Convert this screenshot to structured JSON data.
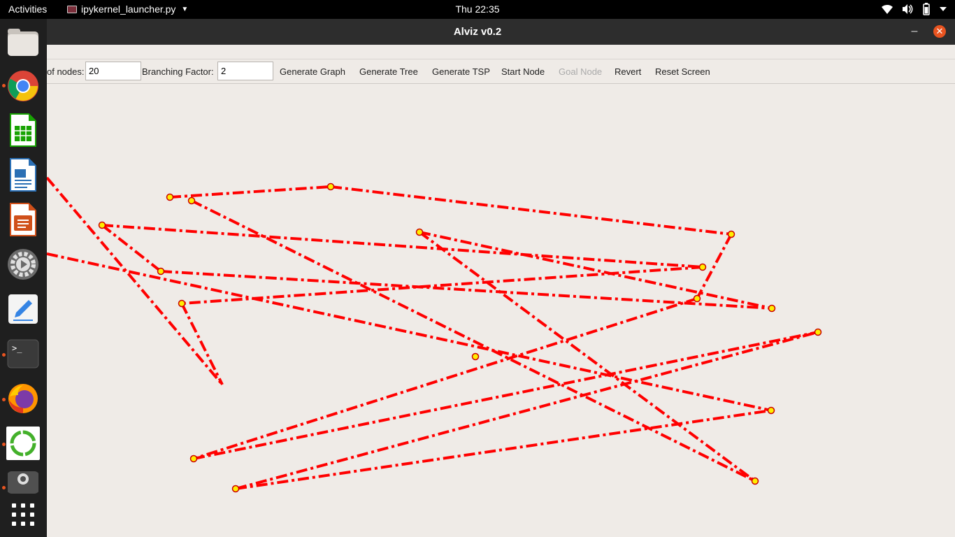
{
  "topbar": {
    "activities": "Activities",
    "app_name": "ipykernel_launcher.py",
    "clock": "Thu 22:35"
  },
  "dock": {
    "items": [
      {
        "name": "files-icon"
      },
      {
        "name": "chrome-icon"
      },
      {
        "name": "libreoffice-calc-icon"
      },
      {
        "name": "libreoffice-writer-icon"
      },
      {
        "name": "libreoffice-impress-icon"
      },
      {
        "name": "settings-icon"
      },
      {
        "name": "text-editor-icon"
      },
      {
        "name": "terminal-icon"
      },
      {
        "name": "firefox-icon"
      },
      {
        "name": "anaconda-icon"
      },
      {
        "name": "screenshot-icon"
      },
      {
        "name": "show-applications-icon"
      }
    ]
  },
  "window": {
    "title": "Alviz v0.2",
    "minimize": "–",
    "close": "✕"
  },
  "toolbar": {
    "nodes_label": "of nodes:",
    "nodes_value": "20",
    "branching_label": "Branching Factor:",
    "branching_value": "2",
    "generate_graph": "Generate Graph",
    "generate_tree": "Generate Tree",
    "generate_tsp": "Generate TSP",
    "start_node": "Start Node",
    "goal_node": "Goal Node",
    "revert": "Revert",
    "reset_screen": "Reset Screen"
  },
  "colors": {
    "edge": "#ff0000",
    "node_fill": "#ffee00",
    "node_stroke": "#cc0000",
    "canvas_bg": "#efebe7"
  }
}
